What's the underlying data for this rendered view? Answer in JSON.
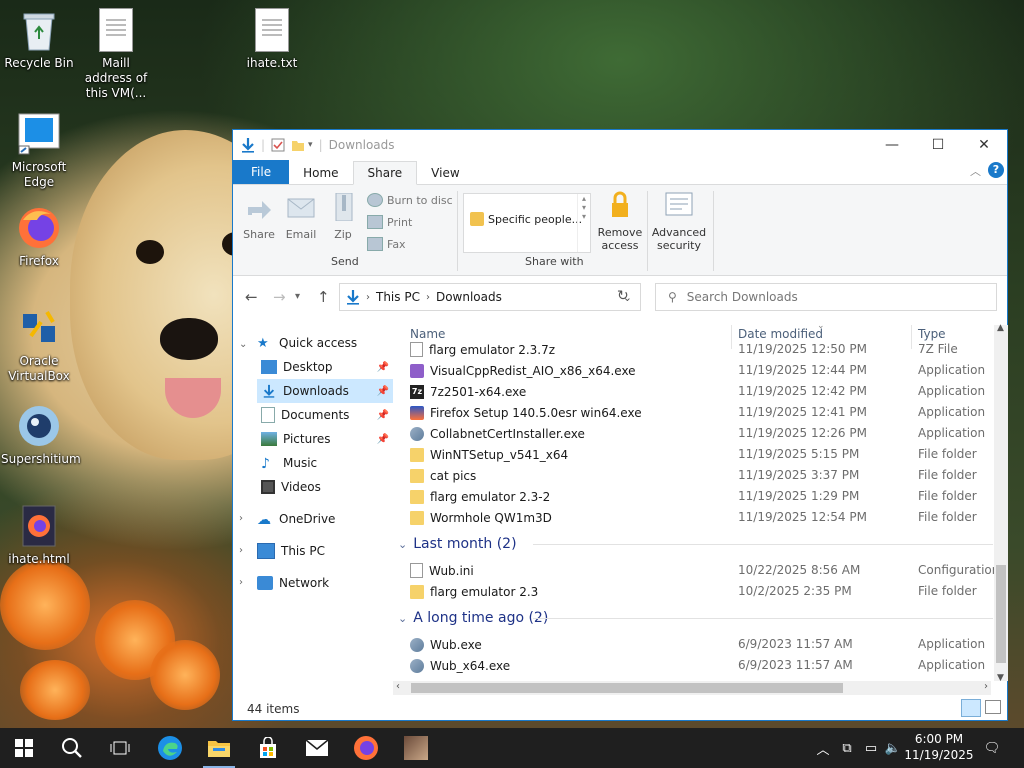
{
  "desktop": {
    "icons": [
      {
        "label": "Recycle Bin",
        "icon": "recycle-bin-icon"
      },
      {
        "label": "Maill address of this VM(...",
        "icon": "text-document-icon"
      },
      {
        "label": "ihate.txt",
        "icon": "text-document-icon"
      },
      {
        "label": "Microsoft Edge",
        "icon": "edge-shortcut-icon"
      },
      {
        "label": "Firefox",
        "icon": "firefox-icon"
      },
      {
        "label": "Oracle VirtualBox",
        "icon": "virtualbox-icon"
      },
      {
        "label": "Supershitium",
        "icon": "supershitium-icon"
      },
      {
        "label": "ihate.html",
        "icon": "firefox-html-icon"
      }
    ]
  },
  "window": {
    "title": "Downloads",
    "controls": {
      "minimize": "—",
      "maximize": "☐",
      "close": "✕"
    },
    "ribbon_tabs": [
      "File",
      "Home",
      "Share",
      "View"
    ],
    "active_tab": "Share",
    "ribbon": {
      "send": {
        "group_label": "Send",
        "share": "Share",
        "email": "Email",
        "zip": "Zip",
        "burn": "Burn to disc",
        "print": "Print",
        "fax": "Fax"
      },
      "share_with": {
        "group_label": "Share with",
        "specific_people": "Specific people...",
        "remove_access": "Remove access",
        "advanced_security": "Advanced security"
      }
    },
    "address": {
      "crumbs": [
        "This PC",
        "Downloads"
      ],
      "search_placeholder": "Search Downloads"
    },
    "nav": {
      "quick_access": "Quick access",
      "quick_items": [
        "Desktop",
        "Downloads",
        "Documents",
        "Pictures",
        "Music",
        "Videos"
      ],
      "selected": "Downloads",
      "onedrive": "OneDrive",
      "this_pc": "This PC",
      "network": "Network"
    },
    "columns": {
      "name": "Name",
      "date": "Date modified",
      "type": "Type"
    },
    "files_today": [
      {
        "name": "flarg emulator 2.3.7z",
        "date": "11/19/2025 12:50 PM",
        "type": "7Z File",
        "icon": "archive-file-icon"
      },
      {
        "name": "VisualCppRedist_AIO_x86_x64.exe",
        "date": "11/19/2025 12:44 PM",
        "type": "Application",
        "icon": "visual-studio-app-icon"
      },
      {
        "name": "7z2501-x64.exe",
        "date": "11/19/2025 12:42 PM",
        "type": "Application",
        "icon": "7zip-app-icon"
      },
      {
        "name": "Firefox Setup 140.5.0esr win64.exe",
        "date": "11/19/2025 12:41 PM",
        "type": "Application",
        "icon": "firefox-setup-icon"
      },
      {
        "name": "CollabnetCertInstaller.exe",
        "date": "11/19/2025 12:26 PM",
        "type": "Application",
        "icon": "installer-app-icon"
      },
      {
        "name": "WinNTSetup_v541_x64",
        "date": "11/19/2025 5:15 PM",
        "type": "File folder",
        "icon": "folder-icon"
      },
      {
        "name": "cat pics",
        "date": "11/19/2025 3:37 PM",
        "type": "File folder",
        "icon": "folder-icon"
      },
      {
        "name": "flarg emulator 2.3-2",
        "date": "11/19/2025 1:29 PM",
        "type": "File folder",
        "icon": "folder-icon"
      },
      {
        "name": "Wormhole QW1m3D",
        "date": "11/19/2025 12:54 PM",
        "type": "File folder",
        "icon": "folder-icon"
      }
    ],
    "group_last_month": "Last month (2)",
    "files_last_month": [
      {
        "name": "Wub.ini",
        "date": "10/22/2025 8:56 AM",
        "type": "Configuration",
        "icon": "config-file-icon"
      },
      {
        "name": "flarg emulator 2.3",
        "date": "10/2/2025 2:35 PM",
        "type": "File folder",
        "icon": "folder-icon"
      }
    ],
    "group_long_ago": "A long time ago (2)",
    "files_long_ago": [
      {
        "name": "Wub.exe",
        "date": "6/9/2023 11:57 AM",
        "type": "Application",
        "icon": "wub-app-icon"
      },
      {
        "name": "Wub_x64.exe",
        "date": "6/9/2023 11:57 AM",
        "type": "Application",
        "icon": "wub-app-icon"
      }
    ],
    "status": "44 items"
  },
  "taskbar": {
    "clock_time": "6:00 PM",
    "clock_date": "11/19/2025"
  },
  "colors": {
    "accent": "#1979ca",
    "taskbar": "#1f1f1f",
    "selection": "#cce8ff",
    "group_header": "#1e3287",
    "folder": "#f6d26a"
  }
}
